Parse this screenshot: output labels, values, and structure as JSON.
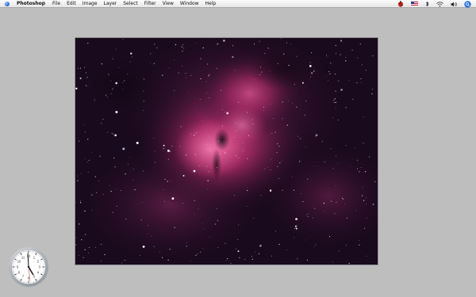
{
  "menubar": {
    "app_name": "Photoshop",
    "menus": [
      "File",
      "Edit",
      "Image",
      "Layer",
      "Select",
      "Filter",
      "View",
      "Window",
      "Help"
    ]
  },
  "tray_icons": [
    "ladybug-icon",
    "us-flag-icon",
    "bluetooth-icon",
    "wifi-icon",
    "volume-icon",
    "spotlight-icon"
  ],
  "document": {
    "image_subject": "nebula"
  },
  "clock_widget": {
    "hour": 4,
    "minute": 59,
    "second": 29
  },
  "colors": {
    "desktop": "#bebebe",
    "menubar": "#eeeeee",
    "spotlight": "#2a6fd8",
    "nebula_core": "#d6407e",
    "space_bg": "#1a0a1e"
  }
}
